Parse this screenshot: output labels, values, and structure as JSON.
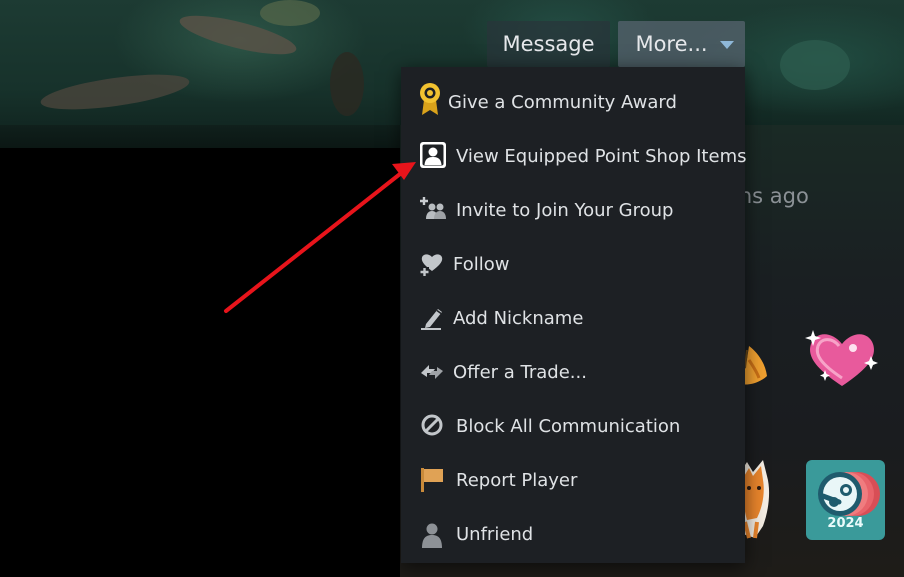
{
  "header": {
    "message_label": "Message",
    "more_label": "More..."
  },
  "status": {
    "partial_text": "ins ago"
  },
  "menu": {
    "items": [
      {
        "label": "Give a Community Award",
        "icon": "award-ribbon-icon"
      },
      {
        "label": "View Equipped Point Shop Items",
        "icon": "profile-portrait-icon"
      },
      {
        "label": "Invite to Join Your Group",
        "icon": "invite-group-icon"
      },
      {
        "label": "Follow",
        "icon": "heart-plus-icon"
      },
      {
        "label": "Add Nickname",
        "icon": "pencil-icon"
      },
      {
        "label": "Offer a Trade...",
        "icon": "trade-arrows-icon"
      },
      {
        "label": "Block All Communication",
        "icon": "block-icon"
      },
      {
        "label": "Report Player",
        "icon": "flag-icon"
      },
      {
        "label": "Unfriend",
        "icon": "person-icon"
      }
    ]
  },
  "badges": {
    "steam_year": "2024"
  },
  "colors": {
    "menu_bg": "#1d2024",
    "menu_text": "#dfe2e5",
    "more_button_bg": "#52606a",
    "caret": "#8fb8d8",
    "annotation_arrow": "#e8141b"
  }
}
